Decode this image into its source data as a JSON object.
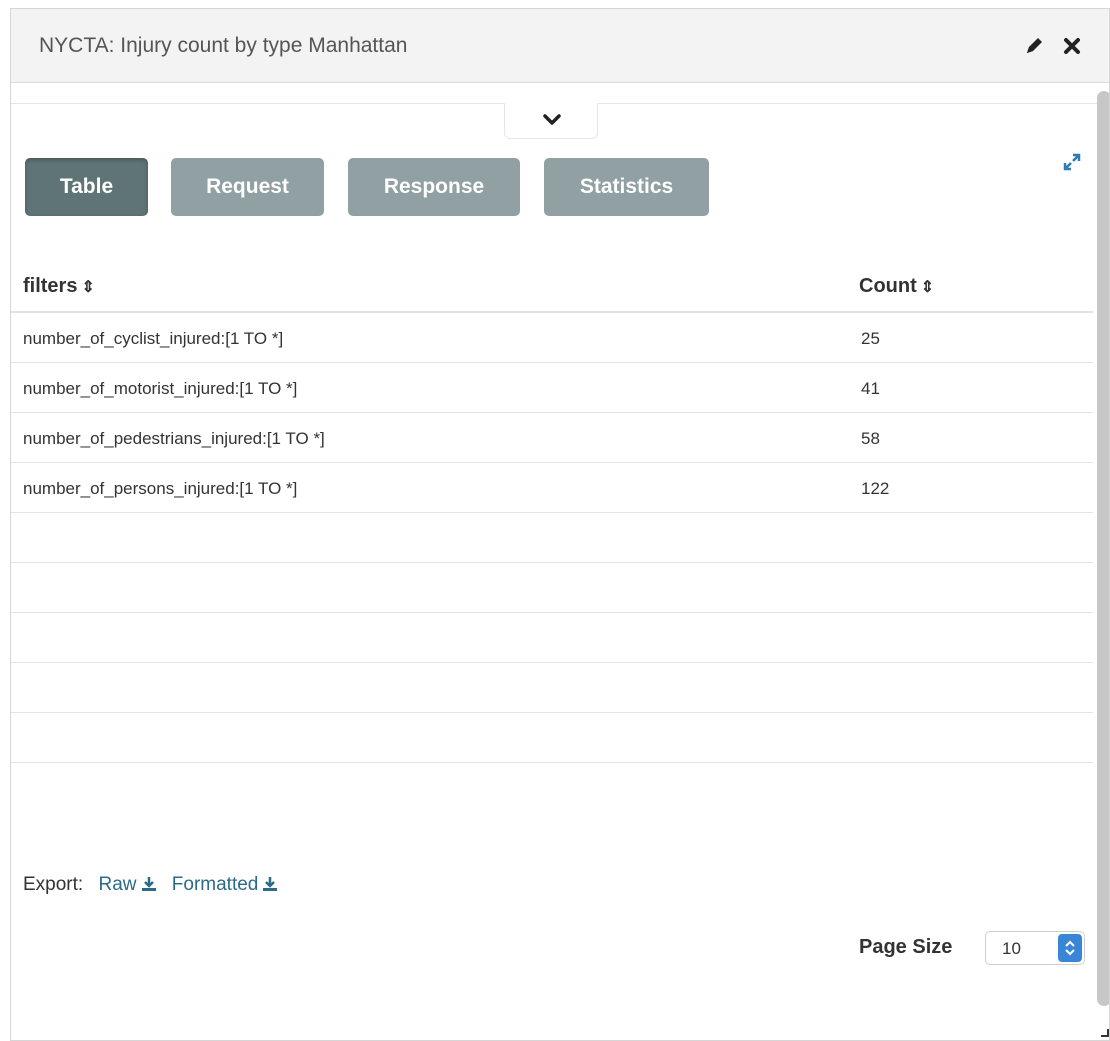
{
  "header": {
    "title": "NYCTA: Injury count by type Manhattan",
    "edit_icon": "pencil-icon",
    "close_icon": "close-icon"
  },
  "tabs": [
    {
      "label": "Table",
      "active": true
    },
    {
      "label": "Request",
      "active": false
    },
    {
      "label": "Response",
      "active": false
    },
    {
      "label": "Statistics",
      "active": false
    }
  ],
  "table": {
    "columns": [
      "filters",
      "Count"
    ],
    "rows": [
      {
        "filter": "number_of_cyclist_injured:[1 TO *]",
        "count": "25"
      },
      {
        "filter": "number_of_motorist_injured:[1 TO *]",
        "count": "41"
      },
      {
        "filter": "number_of_pedestrians_injured:[1 TO *]",
        "count": "58"
      },
      {
        "filter": "number_of_persons_injured:[1 TO *]",
        "count": "122"
      }
    ]
  },
  "export": {
    "label": "Export:",
    "raw": "Raw",
    "formatted": "Formatted"
  },
  "page_size": {
    "label": "Page Size",
    "value": "10"
  },
  "colors": {
    "tab_active": "#5f7477",
    "tab_inactive": "#90a0a3",
    "link": "#2c6a8a",
    "select_button": "#3a86d6"
  }
}
